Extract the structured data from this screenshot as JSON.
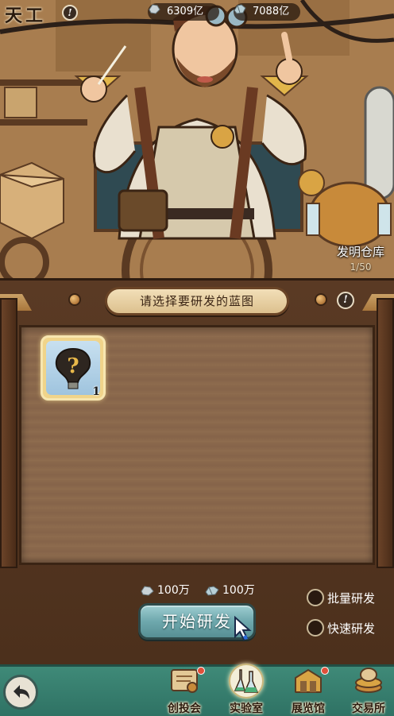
{
  "header": {
    "title": "天工",
    "resources": [
      {
        "icon": "silver-ore-icon",
        "value": "6309亿"
      },
      {
        "icon": "crystal-ore-icon",
        "value": "7088亿"
      }
    ]
  },
  "warehouse": {
    "label": "发明仓库",
    "count": "1/50"
  },
  "panel": {
    "banner": "请选择要研发的蓝图",
    "slots": [
      {
        "icon": "mystery-blueprint-icon",
        "count": "1"
      }
    ]
  },
  "costs": [
    {
      "icon": "silver-ore-icon",
      "value": "100万"
    },
    {
      "icon": "crystal-ore-icon",
      "value": "100万"
    }
  ],
  "actions": {
    "start_label": "开始研发"
  },
  "options": [
    {
      "label": "批量研发",
      "checked": false
    },
    {
      "label": "快速研发",
      "checked": false
    }
  ],
  "nav": [
    {
      "label": "创投会",
      "icon": "blueprint-scroll-icon",
      "badge": true
    },
    {
      "label": "实验室",
      "icon": "lab-flask-icon",
      "badge": false,
      "active": true
    },
    {
      "label": "展览馆",
      "icon": "exhibit-icon",
      "badge": true
    },
    {
      "label": "交易所",
      "icon": "trade-coin-icon",
      "badge": false
    }
  ],
  "colors": {
    "accent": "#6ea8ad",
    "bar": "#3f8a78",
    "badge": "#e0503a"
  }
}
